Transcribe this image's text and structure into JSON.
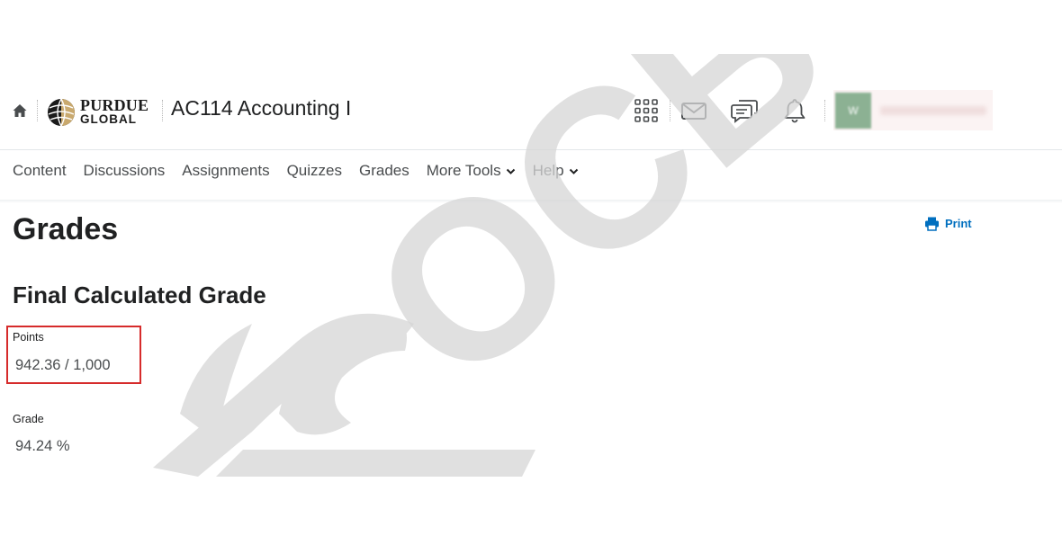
{
  "header": {
    "logo_line1": "PURDUE",
    "logo_line2": "GLOBAL",
    "course_title": "AC114 Accounting I",
    "avatar_initials": "W"
  },
  "icons": {
    "home": "home-icon",
    "apps": "waffle-grid-icon",
    "mail": "mail-icon",
    "chat": "chat-bubbles-icon",
    "notifications": "bell-icon",
    "print": "printer-icon",
    "chevron": "chevron-down-icon"
  },
  "nav": {
    "items": [
      {
        "label": "Content"
      },
      {
        "label": "Discussions"
      },
      {
        "label": "Assignments"
      },
      {
        "label": "Quizzes"
      },
      {
        "label": "Grades"
      },
      {
        "label": "More Tools"
      },
      {
        "label": "Help"
      }
    ]
  },
  "page": {
    "title": "Grades",
    "print_label": "Print",
    "section_title": "Final Calculated Grade",
    "points_label": "Points",
    "points_value": "942.36 / 1,000",
    "grade_label": "Grade",
    "grade_value": "94.24 %"
  },
  "watermark": {
    "text": "OCB"
  },
  "colors": {
    "link": "#006fbf",
    "highlight_border": "#d62b2b",
    "watermark": "#e3e3e3"
  }
}
